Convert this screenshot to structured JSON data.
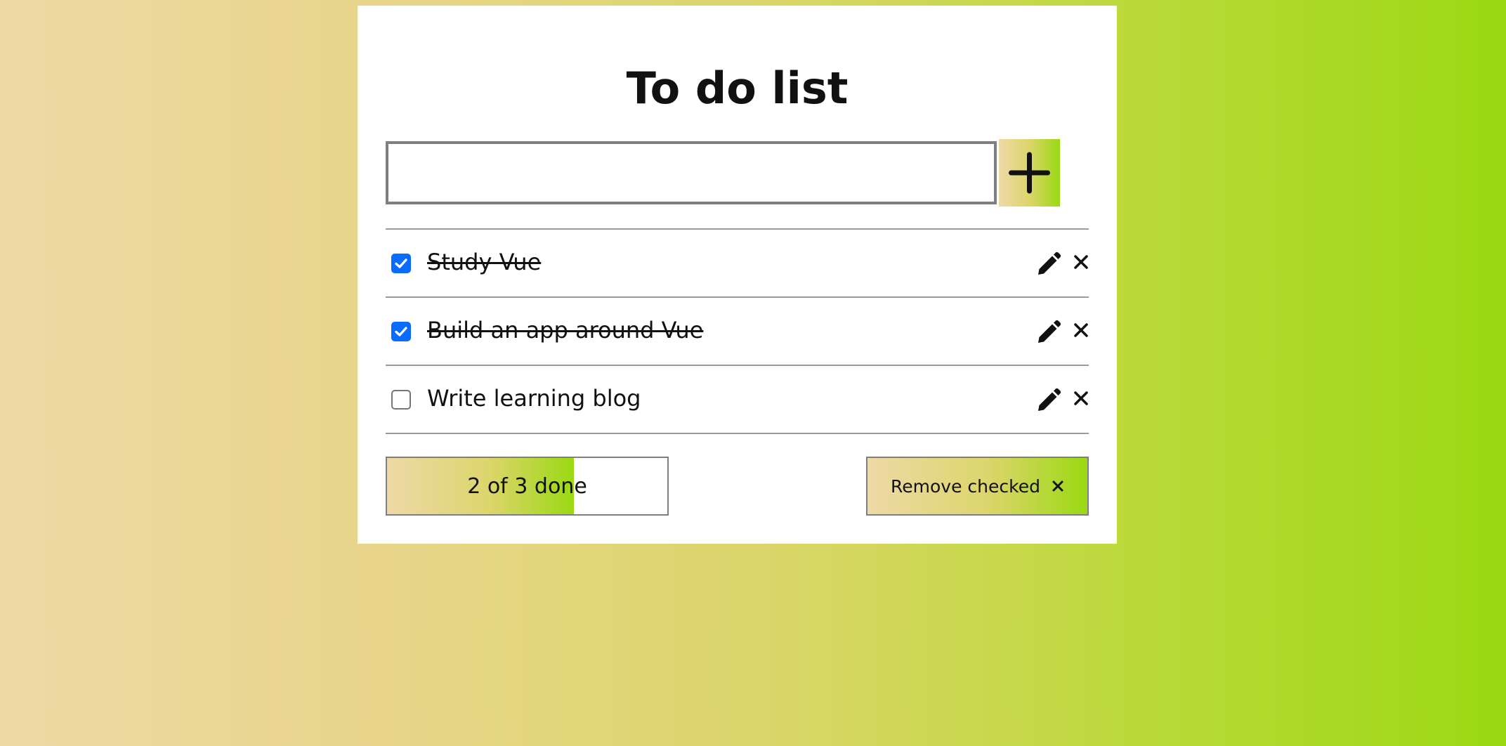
{
  "app": {
    "title": "To do list"
  },
  "new_todo": {
    "value": "",
    "placeholder": "",
    "add_icon": "plus-icon"
  },
  "todos": [
    {
      "text": "Study Vue",
      "done": true,
      "edit_icon": "pencil-icon",
      "delete_icon": "close-icon"
    },
    {
      "text": "Build an app around Vue",
      "done": true,
      "edit_icon": "pencil-icon",
      "delete_icon": "close-icon"
    },
    {
      "text": "Write learning blog",
      "done": false,
      "edit_icon": "pencil-icon",
      "delete_icon": "close-icon"
    }
  ],
  "footer": {
    "progress_label": "2 of 3 done",
    "progress_fraction": 0.6667,
    "remove_label": "Remove checked",
    "remove_icon": "close-icon"
  },
  "colors": {
    "gradient_start": "#eed9a6",
    "gradient_mid": "#dcd56b",
    "gradient_end": "#9ad912",
    "checkbox_accent": "#0a6cff",
    "border": "#7f7f7f",
    "divider": "#9a9a9a"
  }
}
